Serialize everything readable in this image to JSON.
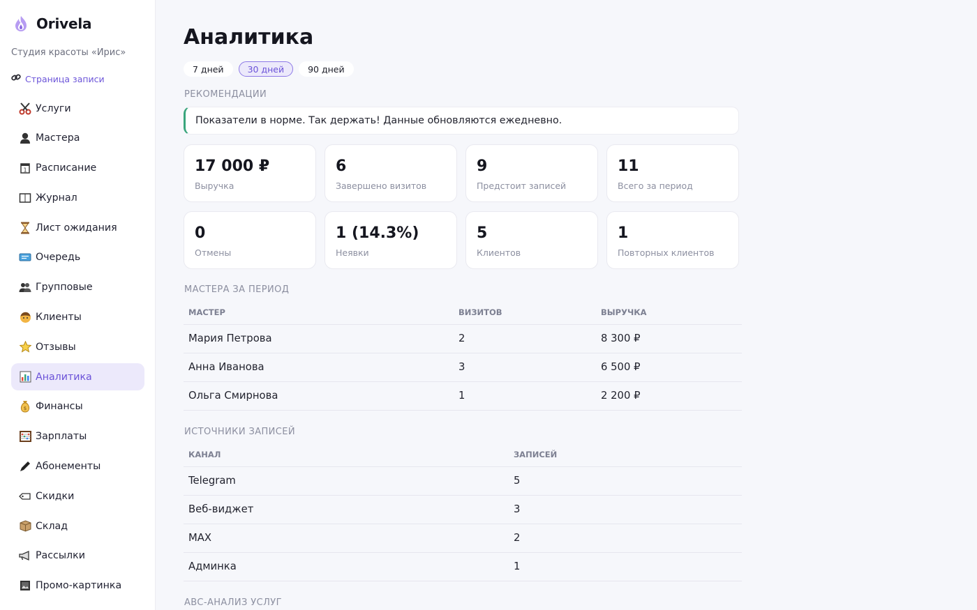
{
  "app": {
    "name": "Orivela",
    "studio": "Студия красоты «Ирис»",
    "booking_link": "Страница записи"
  },
  "sidebar": {
    "items": [
      {
        "label": "Услуги",
        "icon": "scissors-icon"
      },
      {
        "label": "Мастера",
        "icon": "person-icon"
      },
      {
        "label": "Расписание",
        "icon": "calendar-icon"
      },
      {
        "label": "Журнал",
        "icon": "book-icon"
      },
      {
        "label": "Лист ожидания",
        "icon": "hourglass-icon"
      },
      {
        "label": "Очередь",
        "icon": "ticket-icon"
      },
      {
        "label": "Групповые",
        "icon": "group-icon"
      },
      {
        "label": "Клиенты",
        "icon": "face-icon"
      },
      {
        "label": "Отзывы",
        "icon": "star-icon"
      },
      {
        "label": "Аналитика",
        "icon": "bar-chart-icon",
        "active": true
      },
      {
        "label": "Финансы",
        "icon": "money-bag-icon"
      },
      {
        "label": "Зарплаты",
        "icon": "abacus-icon"
      },
      {
        "label": "Абонементы",
        "icon": "pen-icon"
      },
      {
        "label": "Скидки",
        "icon": "tag-icon"
      },
      {
        "label": "Склад",
        "icon": "box-icon"
      },
      {
        "label": "Рассылки",
        "icon": "megaphone-icon"
      },
      {
        "label": "Промо-картинка",
        "icon": "image-icon"
      }
    ]
  },
  "main": {
    "title": "Аналитика",
    "periods": [
      {
        "label": "7 дней",
        "active": false
      },
      {
        "label": "30 дней",
        "active": true
      },
      {
        "label": "90 дней",
        "active": false
      }
    ],
    "recommendations": {
      "label": "Рекомендации",
      "text": "Показатели в норме. Так держать! Данные обновляются ежедневно."
    },
    "kpis": [
      {
        "value": "17 000 ₽",
        "label": "Выручка"
      },
      {
        "value": "6",
        "label": "Завершено визитов"
      },
      {
        "value": "9",
        "label": "Предстоит записей"
      },
      {
        "value": "11",
        "label": "Всего за период"
      },
      {
        "value": "0",
        "label": "Отмены"
      },
      {
        "value": "1 (14.3%)",
        "label": "Неявки"
      },
      {
        "value": "5",
        "label": "Клиентов"
      },
      {
        "value": "1",
        "label": "Повторных клиентов"
      }
    ],
    "masters": {
      "label": "Мастера за период",
      "columns": [
        "Мастер",
        "Визитов",
        "Выручка"
      ],
      "rows": [
        [
          "Мария Петрова",
          "2",
          "8 300 ₽"
        ],
        [
          "Анна Иванова",
          "3",
          "6 500 ₽"
        ],
        [
          "Ольга Смирнова",
          "1",
          "2 200 ₽"
        ]
      ]
    },
    "sources": {
      "label": "Источники записей",
      "columns": [
        "Канал",
        "Записей"
      ],
      "rows": [
        [
          "Telegram",
          "5"
        ],
        [
          "Веб-виджет",
          "3"
        ],
        [
          "MAX",
          "2"
        ],
        [
          "Админка",
          "1"
        ]
      ]
    },
    "abc": {
      "label": "ABC-анализ услуг"
    }
  },
  "colors": {
    "accent": "#6b52d8",
    "accent_bg": "#ece9fb",
    "success": "#3aa57c",
    "page_bg": "#f6f7fb"
  }
}
